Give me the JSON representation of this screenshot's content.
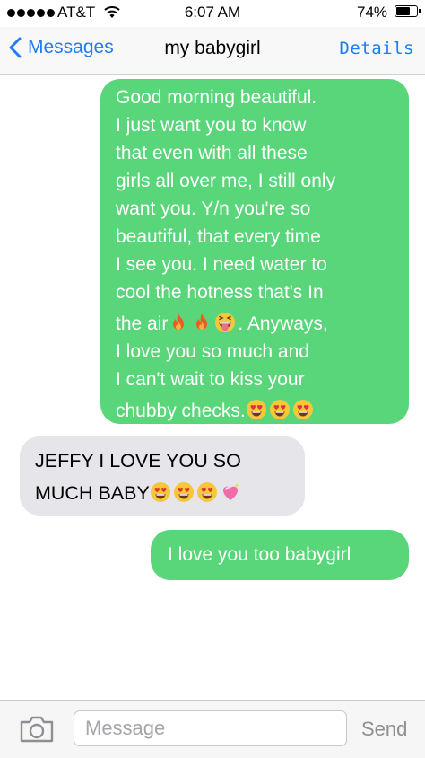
{
  "status_bar": {
    "carrier": "AT&T",
    "time": "6:07 AM",
    "battery_text": "74%",
    "battery_level": 0.74,
    "signal_bars": 5
  },
  "nav": {
    "back_label": "Messages",
    "title": "my babygirl",
    "details_label": "Details"
  },
  "messages": [
    {
      "direction": "sent",
      "lines": [
        "Good morning beautiful.",
        "I just want you to know",
        "that even with all these",
        "girls all over me, I still only",
        "want you. Y/n you're so",
        "beautiful, that every time",
        "I see you. I need water to",
        "cool the hotness that's In",
        "the air",
        ". Anyways,",
        "I love you so much and",
        "I can't wait to kiss your",
        "chubby checks."
      ],
      "emoji": [
        "fire-emoji",
        "fire-emoji",
        "tongue-emoji",
        "heart-eyes-emoji",
        "heart-eyes-emoji",
        "heart-eyes-emoji"
      ]
    },
    {
      "direction": "received",
      "lines": [
        "JEFFY I LOVE YOU SO",
        "MUCH BABY"
      ],
      "emoji": [
        "heart-eyes-emoji",
        "heart-eyes-emoji",
        "heart-eyes-emoji",
        "sparkling-heart-emoji"
      ]
    },
    {
      "direction": "sent",
      "lines": [
        "I love you too babygirl"
      ]
    }
  ],
  "input_bar": {
    "placeholder": "Message",
    "value": "",
    "send_label": "Send"
  },
  "colors": {
    "accent": "#1e7cf6",
    "sent_bubble": "#59d679",
    "received_bubble": "#e5e5ea"
  }
}
